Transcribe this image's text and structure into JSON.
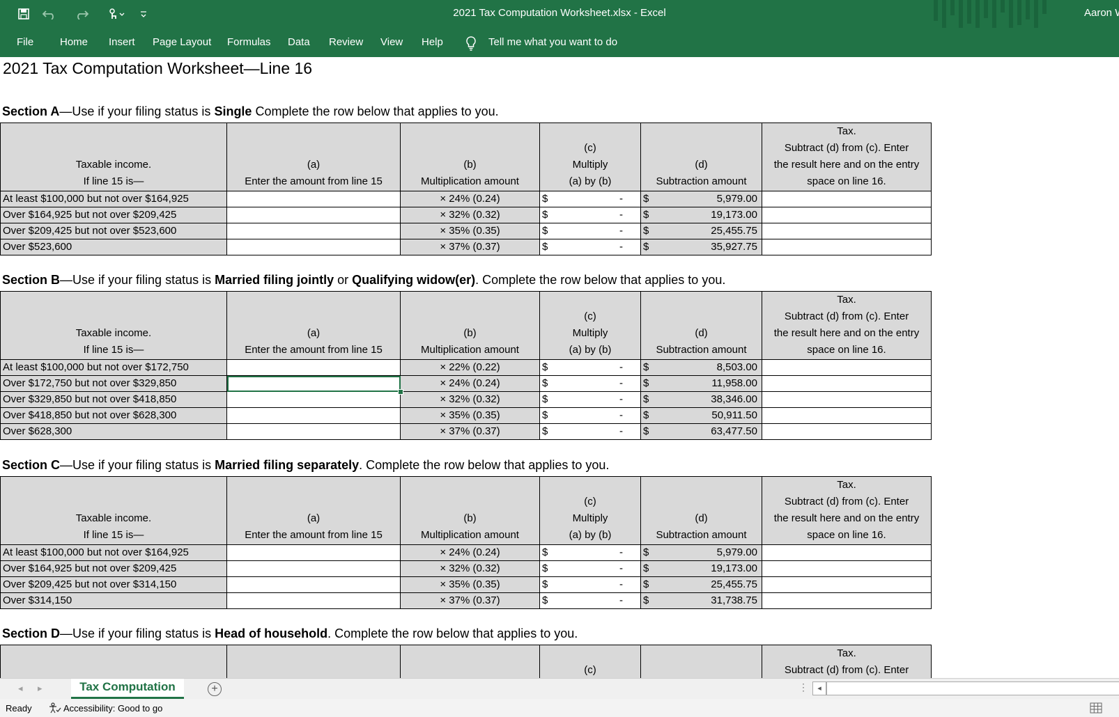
{
  "window": {
    "title": "2021 Tax Computation Worksheet.xlsx  -  Excel",
    "user": "Aaron W"
  },
  "quick_access": {
    "icons": [
      "save-icon",
      "undo-icon",
      "redo-icon",
      "touch-mode-icon",
      "customize-qat-icon"
    ]
  },
  "ribbon": {
    "tabs": [
      "File",
      "Home",
      "Insert",
      "Page Layout",
      "Formulas",
      "Data",
      "Review",
      "View",
      "Help"
    ],
    "tell_me": "Tell me what you want to do"
  },
  "sheet": {
    "title": "2021 Tax Computation Worksheet—Line 16",
    "headers": {
      "income": [
        "Taxable income.",
        "If line 15 is—"
      ],
      "a": [
        "(a)",
        "Enter the amount from line 15"
      ],
      "b": [
        "(b)",
        "Multiplication amount"
      ],
      "c": [
        "(c)",
        "Multiply",
        "(a) by (b)"
      ],
      "d": [
        "(d)",
        "Subtraction amount"
      ],
      "tax": [
        "Tax.",
        "Subtract (d) from (c). Enter",
        "the result here and on the entry",
        "space on line 16."
      ]
    },
    "currency": "$",
    "dash": "-",
    "sections": [
      {
        "heading": [
          {
            "text": "Section A",
            "bold": true
          },
          {
            "text": "—Use if your filing status is ",
            "bold": false
          },
          {
            "text": "Single",
            "bold": true
          },
          {
            "text": " Complete the row below that applies to you.",
            "bold": false
          }
        ],
        "rows": [
          {
            "income": "At least $100,000 but not over $164,925",
            "mult": "× 24% (0.24)",
            "sub": "5,979.00"
          },
          {
            "income": "Over $164,925 but not over $209,425",
            "mult": "× 32% (0.32)",
            "sub": "19,173.00"
          },
          {
            "income": "Over $209,425 but not over $523,600",
            "mult": "× 35% (0.35)",
            "sub": "25,455.75"
          },
          {
            "income": "Over $523,600",
            "mult": "× 37% (0.37)",
            "sub": "35,927.75"
          }
        ]
      },
      {
        "heading": [
          {
            "text": "Section B",
            "bold": true
          },
          {
            "text": "—Use if your filing status is ",
            "bold": false
          },
          {
            "text": "Married filing jointly",
            "bold": true
          },
          {
            "text": " or ",
            "bold": false
          },
          {
            "text": "Qualifying widow(er)",
            "bold": true
          },
          {
            "text": ". Complete the row below that applies to you.",
            "bold": false
          }
        ],
        "rows": [
          {
            "income": "At least $100,000 but not over $172,750",
            "mult": "× 22% (0.22)",
            "sub": "8,503.00"
          },
          {
            "income": "Over $172,750 but not over $329,850",
            "mult": "× 24% (0.24)",
            "sub": "11,958.00"
          },
          {
            "income": "Over $329,850 but not over $418,850",
            "mult": "× 32% (0.32)",
            "sub": "38,346.00"
          },
          {
            "income": "Over $418,850 but not over $628,300",
            "mult": "× 35% (0.35)",
            "sub": "50,911.50"
          },
          {
            "income": "Over $628,300",
            "mult": "× 37% (0.37)",
            "sub": "63,477.50"
          }
        ]
      },
      {
        "heading": [
          {
            "text": "Section C",
            "bold": true
          },
          {
            "text": "—Use if your filing status is ",
            "bold": false
          },
          {
            "text": "Married filing separately",
            "bold": true
          },
          {
            "text": ". Complete the row below that applies to you.",
            "bold": false
          }
        ],
        "rows": [
          {
            "income": "At least $100,000 but not over $164,925",
            "mult": "× 24% (0.24)",
            "sub": "5,979.00"
          },
          {
            "income": "Over $164,925 but not over $209,425",
            "mult": "× 32% (0.32)",
            "sub": "19,173.00"
          },
          {
            "income": "Over $209,425 but not over $314,150",
            "mult": "× 35% (0.35)",
            "sub": "25,455.75"
          },
          {
            "income": "Over $314,150",
            "mult": "× 37% (0.37)",
            "sub": "31,738.75"
          }
        ]
      },
      {
        "heading": [
          {
            "text": "Section D",
            "bold": true
          },
          {
            "text": "—Use if your filing status is ",
            "bold": false
          },
          {
            "text": "Head of household",
            "bold": true
          },
          {
            "text": ". Complete the row below that applies to you.",
            "bold": false
          }
        ],
        "rows": []
      }
    ],
    "selected_cell": {
      "section": 1,
      "row": 1
    }
  },
  "tabs_bar": {
    "sheet_tab": "Tax Computation",
    "add_sheet": "+"
  },
  "status": {
    "ready": "Ready",
    "accessibility": "Accessibility: Good to go"
  },
  "colors": {
    "accent": "#217346",
    "header_fill": "#d9d9d9"
  }
}
